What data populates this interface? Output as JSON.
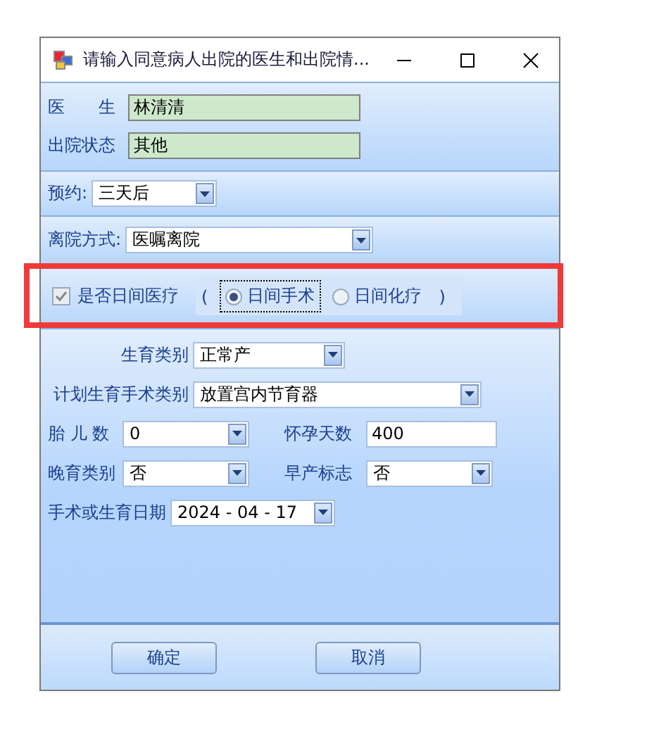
{
  "window": {
    "title": "请输入同意病人出院的医生和出院情..."
  },
  "info_fields": [
    {
      "label": "医　　生",
      "value": "林清清"
    },
    {
      "label": "出院状态",
      "value": "其他"
    }
  ],
  "appointment": {
    "label": "预约:",
    "value": "三天后"
  },
  "discharge_method": {
    "label": "离院方式:",
    "value": "医嘱离院"
  },
  "day_care": {
    "label": "是否日间医疗",
    "checked": true,
    "disabled": true,
    "open": "(",
    "close": ")",
    "options": [
      {
        "label": "日间手术",
        "selected": true
      },
      {
        "label": "日间化疗",
        "selected": false
      }
    ]
  },
  "form_rows": [
    [
      {
        "kind": "select",
        "label": "生育类别",
        "value": "正常产"
      }
    ],
    [
      {
        "kind": "select",
        "label": "计划生育手术类别",
        "value": "放置宫内节育器"
      }
    ],
    [
      {
        "kind": "select",
        "label": "胎 儿 数",
        "value": "0"
      },
      {
        "kind": "input",
        "label": "怀孕天数",
        "value": "400"
      }
    ],
    [
      {
        "kind": "select",
        "label": "晚育类别",
        "value": "否"
      },
      {
        "kind": "select",
        "label": "早产标志",
        "value": "否"
      }
    ],
    [
      {
        "kind": "date",
        "label": "手术或生育日期",
        "value": "2024 - 04 - 17"
      }
    ]
  ],
  "buttons": [
    "确定",
    "取消"
  ],
  "highlight": {
    "on": true
  }
}
